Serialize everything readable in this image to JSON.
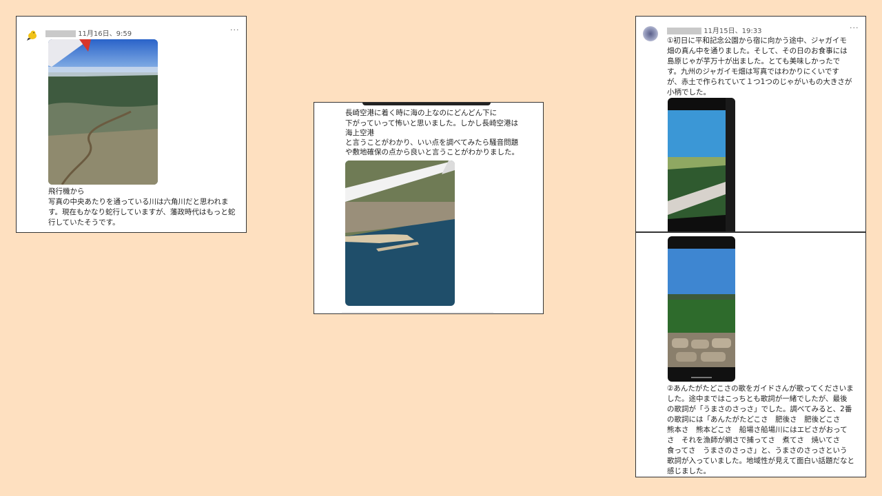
{
  "post1": {
    "timestamp": "11月16日、9:59",
    "menu_icon": "ellipsis-icon",
    "avatar_icon": "bird-avatar-icon",
    "caption_line1": "飛行機から",
    "caption_body": "写真の中央あたりを通っている川は六角川だと思われます。現在もかなり蛇行していますが、藩政時代はもっと蛇行していたそうです。"
  },
  "post2": {
    "line1": "長崎空港に着く時に海の上なのにどんどん下に",
    "line2": "下がっていって怖いと思いました。しかし長崎空港は",
    "line3": "海上空港",
    "line4": "と言うことがわかり、いい点を調べてみたら騒音問題",
    "line5": "や敷地確保の点から良いと言うことがわかりました。"
  },
  "post3": {
    "timestamp": "11月15日、19:33",
    "menu_icon": "ellipsis-icon",
    "text": "①初日に平和記念公園から宿に向かう途中、ジャガイモ畑の真ん中を通りました。そして、その日のお食事には島原じゃが芋万十が出ました。とても美味しかったです。九州のジャガイモ畑は写真ではわかりにくいですが、赤土で作られていて１つ1つのじゃがいもの大きさが小柄でした。"
  },
  "post4": {
    "text": "②あんたがたどこさの歌をガイドさんが歌ってくださいました。途中まではこっちとも歌詞が一緒でしたが、最後の歌詞が「うまさのさっさ」でした。調べてみると、2番の歌詞には「あんたがたどこさ　肥後さ　肥後どこさ　熊本さ　熊本どこさ　船場さ船場川にはエビさがおってさ　それを漁師が網さで捕ってさ　煮てさ　焼いてさ　食ってさ　うまさのさっさ」と、うまさのさっさという歌詞が入っていました。地域性が見えて面白い話題だなと感じました。"
  }
}
